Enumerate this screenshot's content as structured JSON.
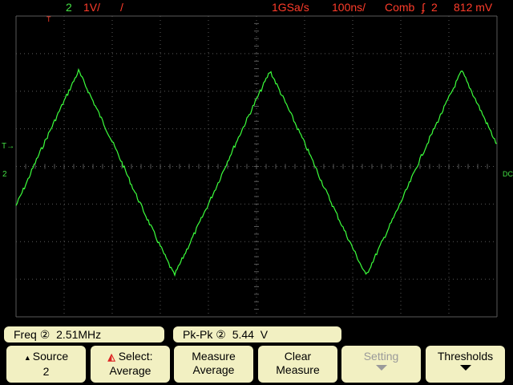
{
  "topbar": {
    "channel": "2",
    "volts_per_div": "1V/",
    "ch_extra": "/",
    "sample_rate": "1GSa/s",
    "time_div": "100ns/",
    "trigger_mode": "Comb",
    "trigger_source": "2",
    "trigger_level": "812 mV"
  },
  "markers": {
    "trigger_marker": "T",
    "ground_marker": "2",
    "dc_label": "DC"
  },
  "measurements": {
    "freq_label": "Freq",
    "freq_value": "2.51MHz",
    "pkpk_label": "Pk-Pk",
    "pkpk_value": "5.44  V",
    "channel_symbol": "②"
  },
  "softkeys": [
    {
      "line1": "Source",
      "line2": "2"
    },
    {
      "line1": "Select:",
      "line2": "Average"
    },
    {
      "line1": "Measure",
      "line2": "Average"
    },
    {
      "line1": "Clear",
      "line2": "Measure"
    },
    {
      "line1": "Setting",
      "line2": ""
    },
    {
      "line1": "Thresholds",
      "line2": ""
    }
  ],
  "colors": {
    "trace": "#3cff3c",
    "grid": "#5a5a5a",
    "label_red": "#ff3c2a",
    "label_green": "#44e044",
    "softkey_bg": "#f2f0c2"
  },
  "waveform": {
    "type": "triangle",
    "frequency_mhz": 2.51,
    "peak_to_peak_v": 5.44,
    "timebase_ns_per_div": 100,
    "vertical_v_per_div": 1
  }
}
